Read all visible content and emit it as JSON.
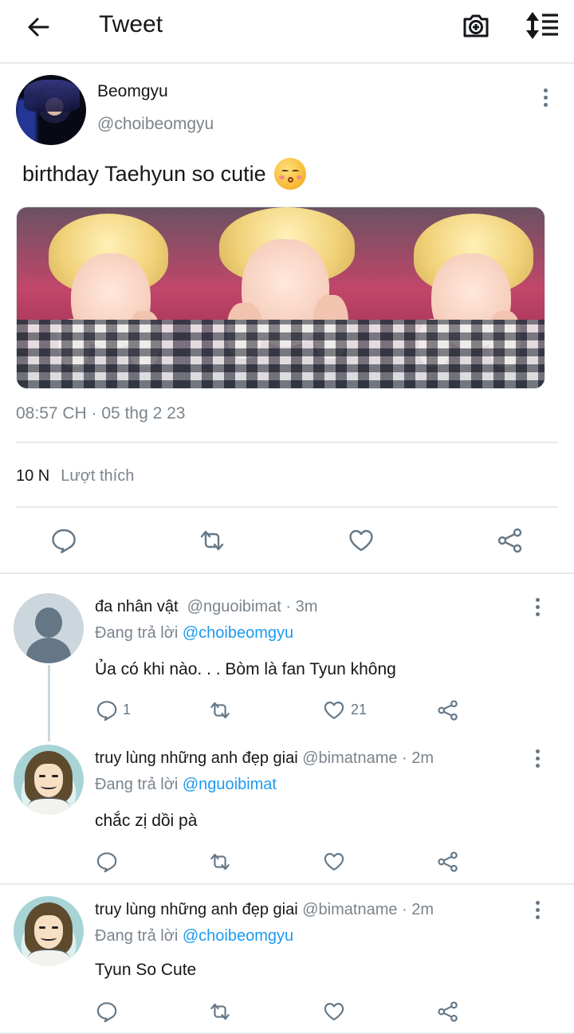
{
  "header": {
    "title": "Tweet",
    "back_icon": "arrow-left-icon",
    "camera_icon": "camera-plus-icon",
    "sort_icon": "sort-icon"
  },
  "tweet": {
    "name": "Beomgyu",
    "handle": "@choibeomgyu",
    "text": "birthday Taehyun so cutie",
    "emoji": "kissing-face-icon",
    "timestamp": "08:57 CH · 05 thg 2 23",
    "likes_count": "10 N",
    "likes_label": "Lượt thích",
    "photo_count": 3
  },
  "replies": [
    {
      "name": "đa nhân vật",
      "meta": "@nguoibimat · 3m",
      "replying_prefix": "Đang trả lời",
      "replying_to": "@choibeomgyu",
      "text": "Ủa có khi nào. . .  Bòm là fan Tyun không",
      "reply_count": "1",
      "like_count": "21"
    },
    {
      "name": "truy lùng những anh đẹp giai",
      "meta": "@bimatname · 2m",
      "replying_prefix": "Đang trả lời",
      "replying_to": "@nguoibimat",
      "text": "chắc zị dồi pà",
      "reply_count": "",
      "like_count": ""
    },
    {
      "name": "truy lùng những anh đẹp giai",
      "meta": "@bimatname · 2m",
      "replying_prefix": "Đang trả lời",
      "replying_to": "@choibeomgyu",
      "text": "Tyun So Cute",
      "reply_count": "",
      "like_count": ""
    }
  ],
  "colors": {
    "accent": "#1d9bf0",
    "secondary_text": "#7b848c",
    "icon": "#657786",
    "divider": "#e6e9eb"
  }
}
